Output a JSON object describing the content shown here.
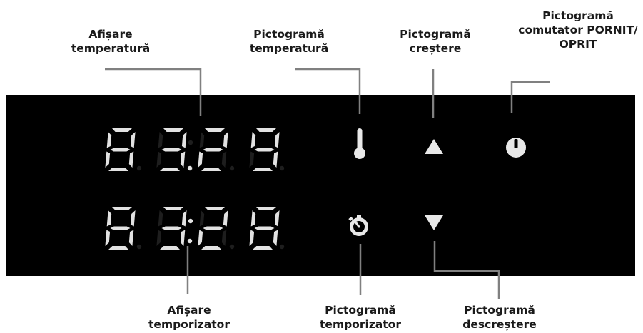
{
  "labels": {
    "temp_display": "Afișare\ntemperatură",
    "temp_icon": "Pictogramă\ntemperatură",
    "up_icon": "Pictogramă\ncreștere",
    "power_icon": "Pictogramă\ncomutator PORNIT/\nOPRIT",
    "timer_display": "Afișare\ntemporizator",
    "timer_icon": "Pictogramă\ntemporizator",
    "down_icon": "Pictogramă\ndescreștere"
  },
  "temperature_display": {
    "digits": [
      "8",
      "3",
      "2",
      "9"
    ],
    "separator": "."
  },
  "timer_display": {
    "digits": [
      "8",
      "3",
      "2",
      "8"
    ],
    "separator": ":"
  },
  "colors": {
    "panel": "#000000",
    "segment_on": "#e2e2e2",
    "segment_dim": "#1e1e1e",
    "icon": "#e8e8e8",
    "leader": "#808080",
    "label": "#1a1a1a"
  },
  "icons": {
    "temperature": "thermometer-icon",
    "up": "triangle-up-icon",
    "power": "power-icon",
    "timer": "timer-icon",
    "down": "triangle-down-icon"
  }
}
